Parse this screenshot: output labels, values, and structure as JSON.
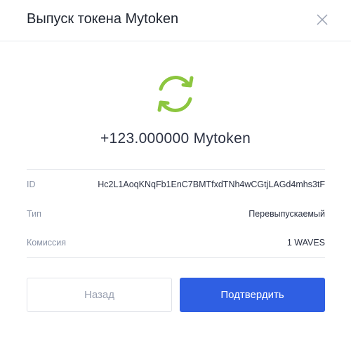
{
  "dialog": {
    "title": "Выпуск токена Mytoken",
    "amount": "+123.000000 Mytoken",
    "details": [
      {
        "label": "ID",
        "value": "Hc2L1AoqKNqFb1EnC7BMTfxdTNh4wCGtjLAGd4mhs3tF"
      },
      {
        "label": "Тип",
        "value": "Перевыпускаемый"
      },
      {
        "label": "Комиссия",
        "value": "1 WAVES"
      }
    ],
    "buttons": {
      "back": "Назад",
      "confirm": "Подтвердить"
    }
  },
  "icons": {
    "close": "close-icon",
    "status": "refresh-icon"
  },
  "colors": {
    "accent": "#2f5fe3",
    "status_icon": "#8cc63f"
  }
}
